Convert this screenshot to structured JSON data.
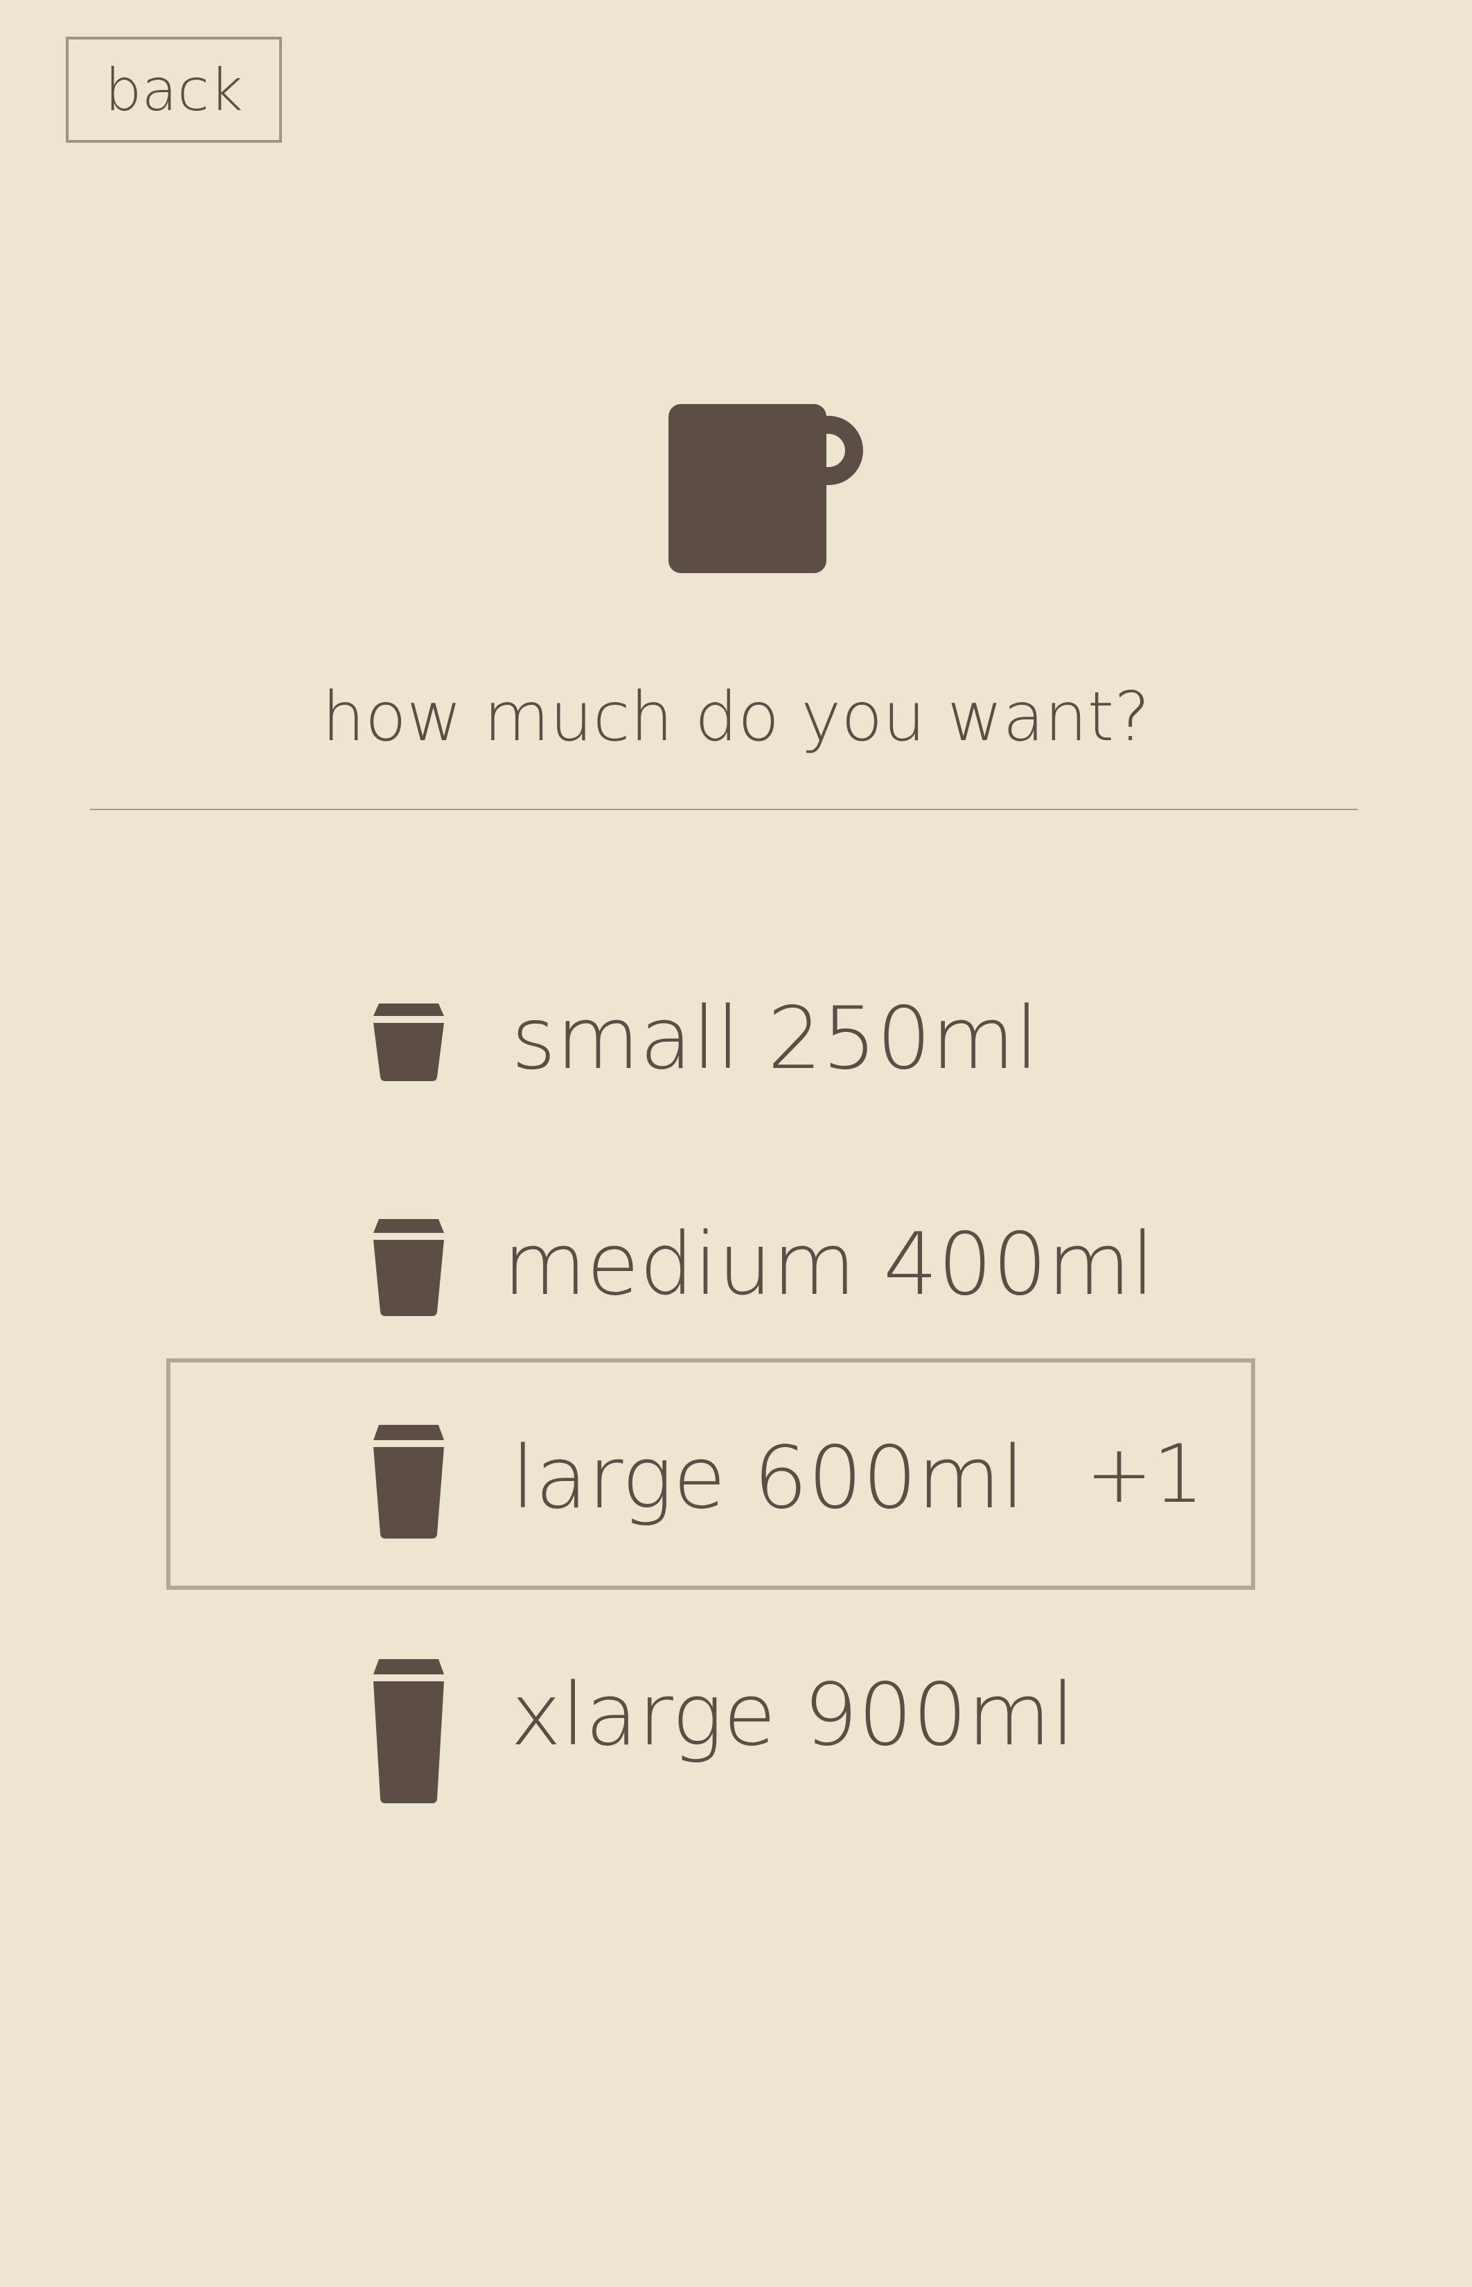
{
  "header": {
    "back_label": "back"
  },
  "main": {
    "prompt": "how much do you want?",
    "sizes": [
      {
        "label": "small 250ml"
      },
      {
        "label": "medium 400ml"
      },
      {
        "label": "large 600ml",
        "badge": "+1",
        "selected": true
      },
      {
        "label": "xlarge 900ml"
      }
    ]
  },
  "icons": {
    "header": "mug-icon",
    "sizes": "takeaway-cup-icon"
  },
  "colors": {
    "background": "#EEE5D0",
    "text": "#5C4E45",
    "icon": "#5C4E45",
    "selected_border": "#B4A796",
    "divider": "#A29A8E"
  }
}
